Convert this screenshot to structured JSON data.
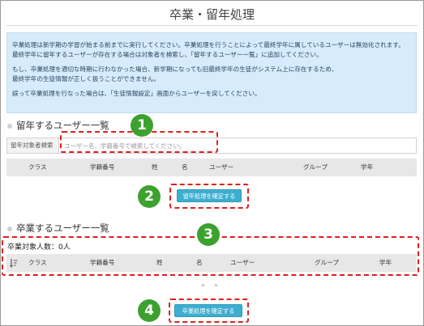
{
  "page": {
    "title": "卒業・留年処理"
  },
  "info": {
    "line1": "卒業処理は新学期の学習が始まる前までに実行してください。卒業処理を行うことによって最終学年に属しているユーザーは無効化されます。",
    "line2": "最終学年に留年するユーザーが存在する場合は対象者を検索し、「留年するユーザー一覧」に追加してください。",
    "line3": "もし、卒業処理を適切な時期に行わなかった場合、新学期になっても旧最終学年の生徒がシステム上に存在するため、",
    "line4": "最終学年の生徒情報が正しく扱うことができません。",
    "line5": "誤って卒業処理を行なった場合は、「生徒情報設定」画面からユーザーを戻してください。"
  },
  "repeat": {
    "title": "留年するユーザー一覧",
    "search_label": "留年対象者検索",
    "search_placeholder": "ユーザー名、学籍番号で検索してください。",
    "columns": [
      "クラス",
      "学籍番号",
      "姓",
      "名",
      "ユーザー",
      "グループ",
      "学年"
    ],
    "confirm_button": "留年処理を確定する"
  },
  "graduate": {
    "title": "卒業するユーザー一覧",
    "count_label": "卒業対象人数：0人",
    "columns": [
      "クラス",
      "学籍番号",
      "姓",
      "名",
      "ユーザー",
      "グループ",
      "学年"
    ],
    "pager_prev": "«",
    "pager_next": "»",
    "confirm_button": "卒業処理を確定する"
  },
  "callouts": [
    "1",
    "2",
    "3",
    "4"
  ],
  "colors": {
    "accent_button": "#3daed0",
    "callout_green": "#3da12f",
    "callout_dash": "#e0201e",
    "info_bg": "#d6ebfb"
  },
  "icons": {
    "sort": "sort-icon"
  }
}
